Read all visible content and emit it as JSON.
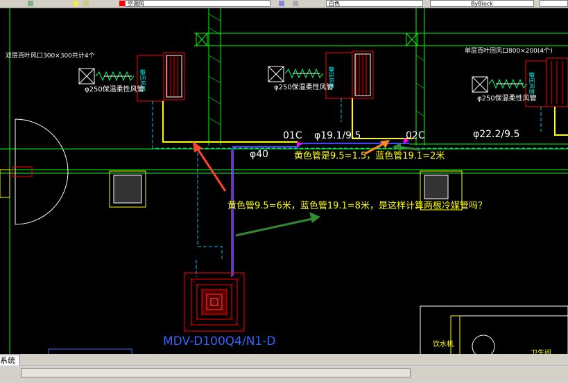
{
  "toolbar": {
    "layer_name": "空调风",
    "color_field": "白色",
    "linetype_field": "ByBlock"
  },
  "drawing": {
    "label_left_vent": "双层百叶风口300×300共计4个",
    "label_right_vent": "单层百叶回风口800×200(4个)",
    "duct_label_1": "φ250保温柔性风管",
    "duct_label_2": "φ250保温柔性风管",
    "duct_label_3": "φ250保温柔性风管",
    "unit_tag": "静压风管",
    "pipe_label_01c": "01C",
    "pipe_label_02c": "02C",
    "pipe_size_1": "φ19.1/9.5",
    "pipe_size_2": "φ22.2/9.5",
    "pipe_size_3": "φ40",
    "indoor_unit_model": "MDV-D100Q4/N1-D",
    "room_label_1": "饮水机",
    "room_label_2": "卫生间"
  },
  "annotations": {
    "note_1": "黄色管是9.5=1.5，蓝色管19.1=2米",
    "note_2": "黄色管9.5=6米，蓝色管19.1=8米，是这样计算两根冷媒管吗？"
  },
  "tabs": {
    "layout_tab": "系统"
  },
  "colors": {
    "background": "#000000",
    "wall": "#00ff00",
    "unit": "#ff0000",
    "yellow_pipe": "#ffff00",
    "blue_pipe": "#4444ff",
    "annotation": "#ffff00",
    "cyan_text": "#00ffff"
  }
}
